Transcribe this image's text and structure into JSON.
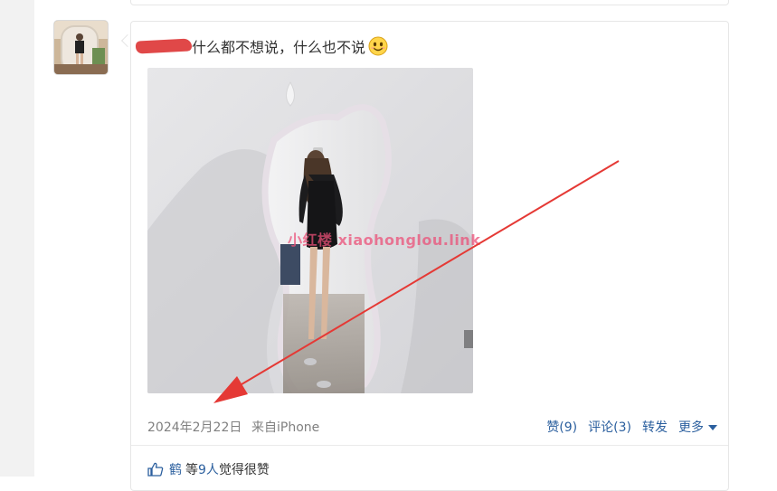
{
  "post": {
    "text": "什么都不想说，什么也不说",
    "photo_watermark": "小红楼  xiaohonglou.link"
  },
  "meta": {
    "date": "2024年2月22日",
    "source": "来自iPhone"
  },
  "actions": {
    "like": "赞(9)",
    "comment": "评论(3)",
    "repost": "转发",
    "more": "更多"
  },
  "likes": {
    "liker": "鹤",
    "prefix": "等",
    "count": "9人",
    "suffix": "觉得很赞"
  },
  "colors": {
    "link": "#2b5f9e",
    "annotation_arrow": "#e53935"
  }
}
